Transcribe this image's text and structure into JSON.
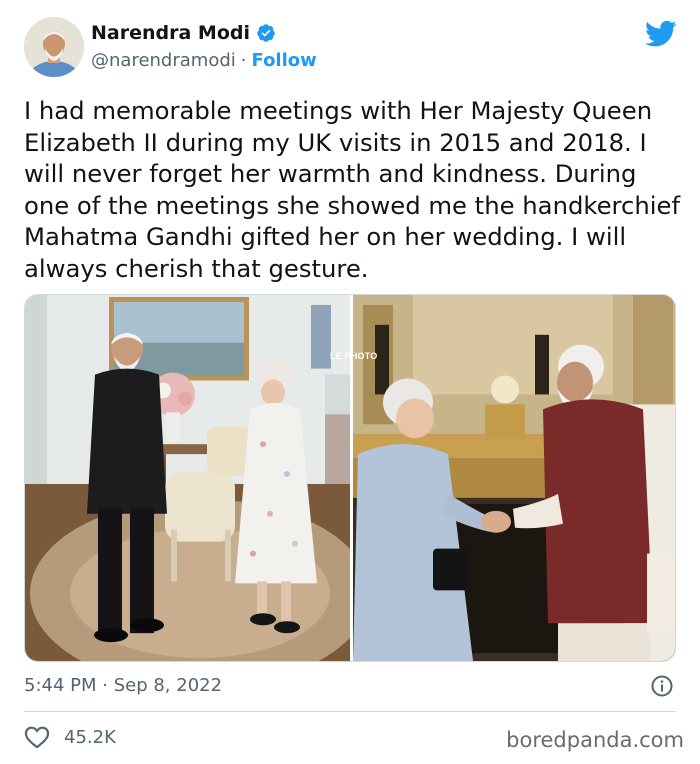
{
  "author": {
    "name": "Narendra Modi",
    "handle": "@narendramodi",
    "separator": "·",
    "follow_label": "Follow",
    "verified_icon": "verified-badge-icon",
    "avatar_icon": "avatar-photo"
  },
  "tweet": {
    "text": "I had memorable meetings with Her Majesty Queen Elizabeth II during my UK visits in 2015 and 2018. I will never forget her warmth and kindness. During one of the meetings she showed me the handkerchief Mahatma Gandhi gifted her on her wedding. I will always cherish that gesture.",
    "photo_credit": "LE PHOTO",
    "timestamp": "5:44 PM · Sep 8, 2022",
    "likes": "45.2K"
  },
  "branding": {
    "watermark": "boredpanda.com",
    "platform_icon": "twitter-bird-icon"
  },
  "colors": {
    "accent": "#1d9bf0",
    "text": "#0f1419",
    "muted": "#536471"
  }
}
